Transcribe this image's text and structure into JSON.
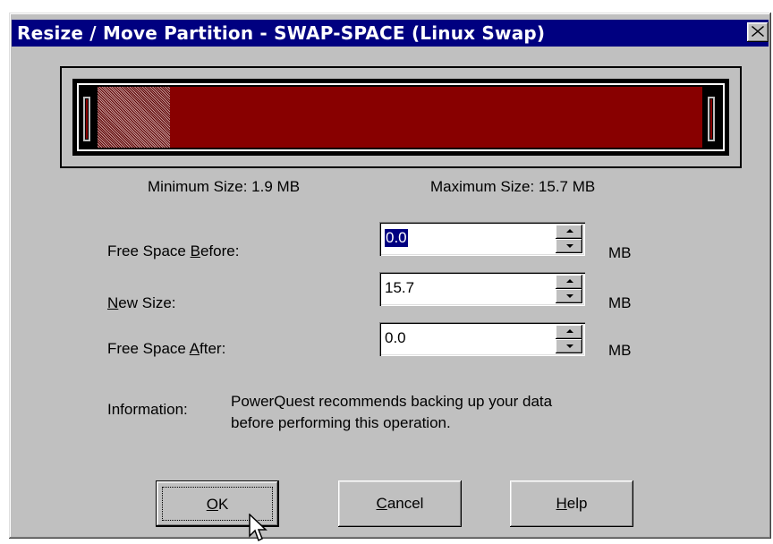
{
  "dialog": {
    "title": "Resize / Move Partition - SWAP-SPACE (Linux Swap)",
    "close_icon": "close-icon"
  },
  "partition_bar": {
    "used_fraction": 0.12,
    "fill_color": "#880000",
    "used_color": "#a05050"
  },
  "sizes": {
    "minimum": "Minimum Size:  1.9 MB",
    "maximum": "Maximum Size:  15.7 MB"
  },
  "fields": [
    {
      "label_pre": "Free Space ",
      "label_u": "B",
      "label_post": "efore:",
      "value": "0.0",
      "unit": "MB",
      "selected": true
    },
    {
      "label_pre": "",
      "label_u": "N",
      "label_post": "ew Size:",
      "value": "15.7",
      "unit": "MB",
      "selected": false
    },
    {
      "label_pre": "Free Space ",
      "label_u": "A",
      "label_post": "fter:",
      "value": "0.0",
      "unit": "MB",
      "selected": false
    }
  ],
  "information": {
    "label": "Information:",
    "line1": "PowerQuest recommends backing up your data",
    "line2": "before performing this operation."
  },
  "buttons": {
    "ok_u": "O",
    "ok_rest": "K",
    "cancel_u": "C",
    "cancel_rest": "ancel",
    "help_u": "H",
    "help_rest": "elp"
  }
}
